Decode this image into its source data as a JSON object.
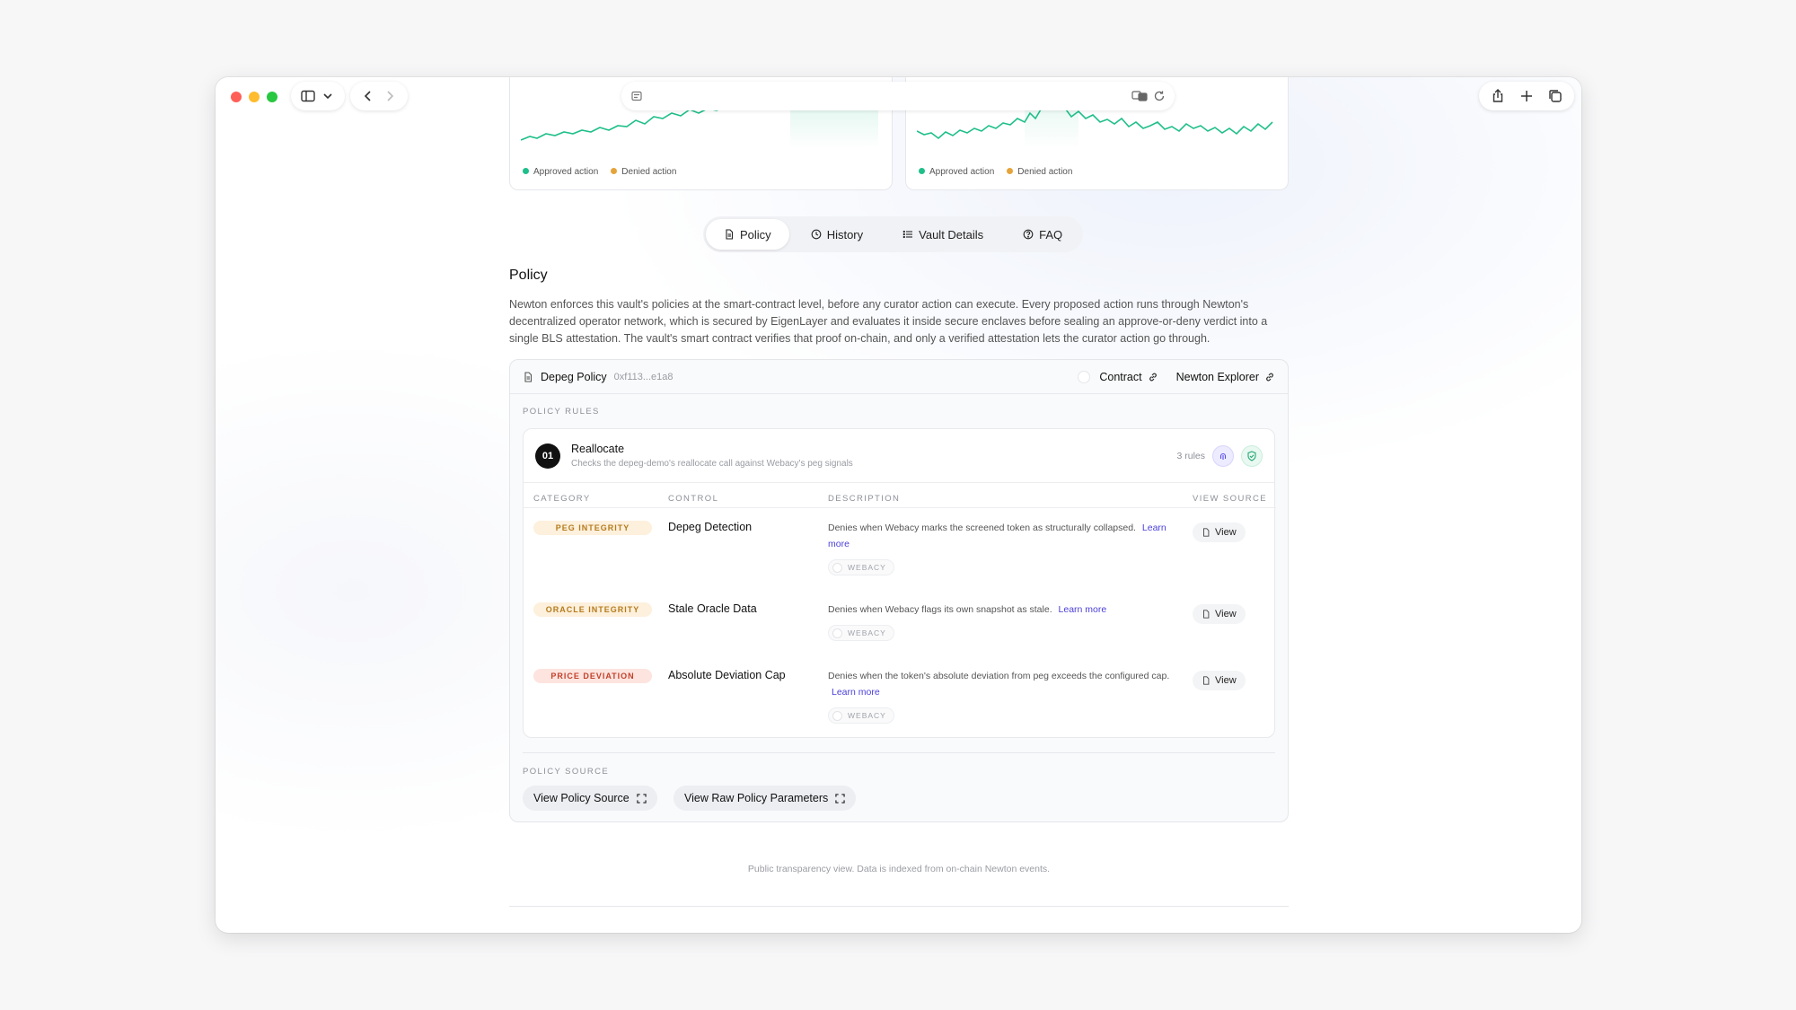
{
  "charts": [
    {
      "legend": [
        "Approved action",
        "Denied action"
      ]
    },
    {
      "legend": [
        "Approved action",
        "Denied action"
      ]
    }
  ],
  "colors": {
    "approved": "#1fbf8a",
    "denied": "#e5a43b"
  },
  "tabs": [
    {
      "label": "Policy",
      "icon": "document-icon"
    },
    {
      "label": "History",
      "icon": "clock-icon"
    },
    {
      "label": "Vault Details",
      "icon": "list-icon"
    },
    {
      "label": "FAQ",
      "icon": "question-icon"
    }
  ],
  "section": {
    "title": "Policy",
    "description": "Newton enforces this vault's policies at the smart-contract level, before any curator action can execute. Every proposed action runs through Newton's decentralized operator network, which is secured by EigenLayer and evaluates it inside secure enclaves before sealing an approve-or-deny verdict into a single BLS attestation. The vault's smart contract verifies that proof on-chain, and only a verified attestation lets the curator action go through."
  },
  "policy": {
    "name": "Depeg Policy",
    "address": "0xf113...e1a8",
    "contract_label": "Contract",
    "explorer_label": "Newton Explorer",
    "rules_label": "POLICY RULES",
    "rule_group": {
      "number": "01",
      "title": "Reallocate",
      "subtitle": "Checks the depeg-demo's reallocate call against Webacy's peg signals",
      "count": "3 rules"
    },
    "columns": [
      "CATEGORY",
      "CONTROL",
      "DESCRIPTION",
      "VIEW SOURCE"
    ],
    "rules": [
      {
        "category": "PEG INTEGRITY",
        "control": "Depeg Detection",
        "description": "Denies when Webacy marks the screened token as structurally collapsed.",
        "learn": "Learn more",
        "source": "WEBACY",
        "view": "View"
      },
      {
        "category": "ORACLE INTEGRITY",
        "control": "Stale Oracle Data",
        "description": "Denies when Webacy flags its own snapshot as stale.",
        "learn": "Learn more",
        "source": "WEBACY",
        "view": "View"
      },
      {
        "category": "PRICE DEVIATION",
        "control": "Absolute Deviation Cap",
        "description": "Denies when the token's absolute deviation from peg exceeds the configured cap.",
        "learn": "Learn more",
        "source": "WEBACY",
        "view": "View"
      }
    ],
    "source_label": "POLICY SOURCE",
    "source_buttons": [
      "View Policy Source",
      "View Raw Policy Parameters"
    ]
  },
  "footer": {
    "note": "Public transparency view. Data is indexed from on-chain Newton events."
  }
}
